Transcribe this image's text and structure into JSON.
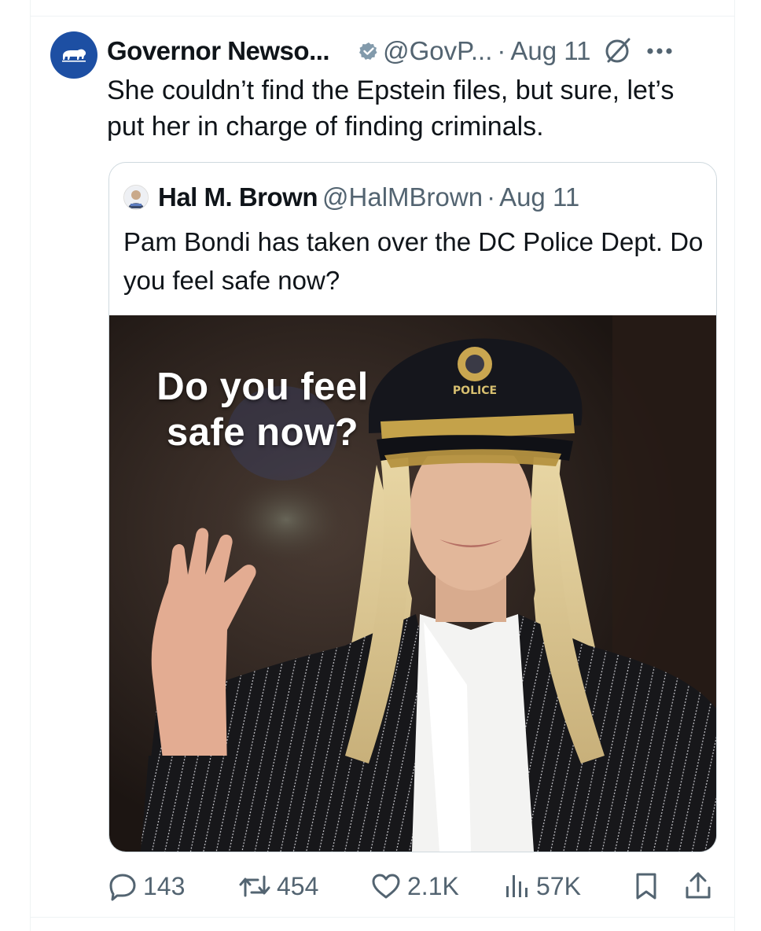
{
  "tweet": {
    "author_name": "Governor Newso...",
    "handle": "@GovP...",
    "separator": "·",
    "time": "Aug 11",
    "text": "She couldn’t find the Epstein files, but sure, let’s put her in charge of finding criminals."
  },
  "quote": {
    "author_name": "Hal M. Brown",
    "handle": "@HalMBrown",
    "separator": "·",
    "time": "Aug 11",
    "text": "Pam Bondi has taken over the DC Police Dept. Do you feel safe now?",
    "image_overlay_text": "Do you feel safe now?",
    "hat_badge_text": "POLICE"
  },
  "actions": {
    "replies": "143",
    "reposts": "454",
    "likes": "2.1K",
    "views": "57K"
  },
  "colors": {
    "avatar_bg": "#1d4fa3",
    "secondary_text": "#536471",
    "border": "#cfd9de"
  },
  "icons": [
    "bear-icon",
    "verified-badge-icon",
    "grok-icon",
    "more-icon",
    "reply-icon",
    "repost-icon",
    "like-icon",
    "views-icon",
    "bookmark-icon",
    "share-icon"
  ]
}
